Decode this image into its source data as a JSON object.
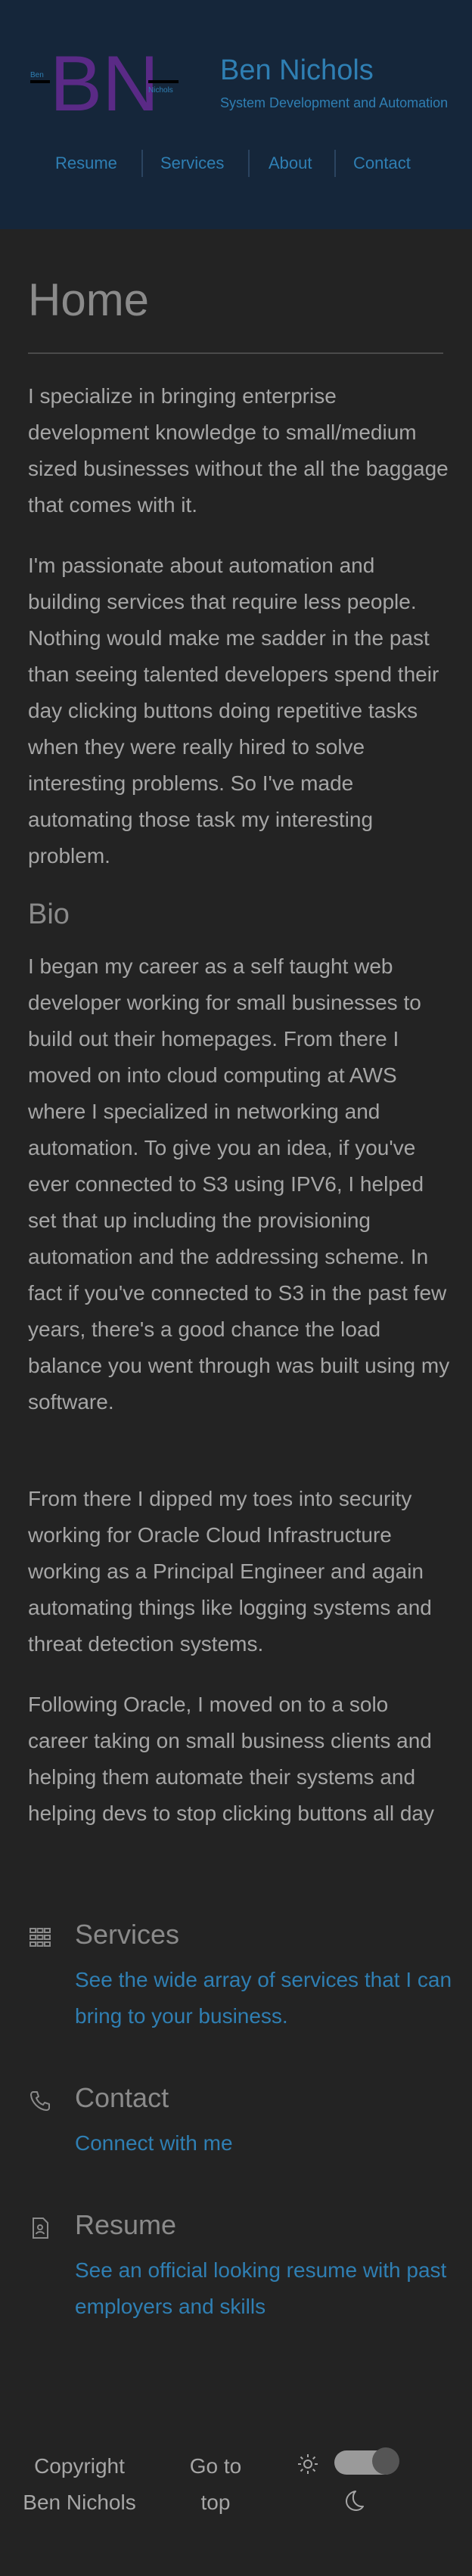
{
  "header": {
    "logo": {
      "letters": "BN",
      "small_left": "Ben",
      "small_right": "Nichols",
      "accent": "#5a2a86"
    },
    "title": "Ben Nichols",
    "subtitle": "System Development and Automation",
    "nav": [
      {
        "label": "Resume"
      },
      {
        "label": "Services"
      },
      {
        "label": "About"
      },
      {
        "label": "Contact"
      }
    ]
  },
  "main": {
    "page_title": "Home",
    "intro": [
      "I specialize in bringing enterprise development knowledge to small/medium sized businesses without the all the baggage that comes with it.",
      "I'm passionate about automation and building services that require less people. Nothing would make me sadder in the past than seeing talented developers spend their day clicking buttons doing repetitive tasks when they were really hired to solve interesting problems. So I've made automating those task my interesting problem."
    ],
    "bio_heading": "Bio",
    "bio": [
      "I began my career as a self taught web developer working for small businesses to build out their homepages. From there I moved on into cloud computing at AWS where I specialized in networking and automation. To give you an idea, if you've ever connected to S3 using IPV6, I helped set that up including the provisioning automation and the addressing scheme. In fact if you've connected to S3 in the past few years, there's a good chance the load balance you went through was built using my software.",
      "From there I dipped my toes into security working for Oracle Cloud Infrastructure working as a Principal Engineer and again automating things like logging systems and threat detection systems.",
      "Following Oracle, I moved on to a solo career taking on small business clients and helping them automate their systems and helping devs to stop clicking buttons all day"
    ],
    "features": [
      {
        "icon": "services-grid-icon",
        "title": "Services",
        "link": "See the wide array of services that I can bring to your business."
      },
      {
        "icon": "phone-icon",
        "title": "Contact",
        "link": "Connect with me"
      },
      {
        "icon": "resume-document-icon",
        "title": "Resume",
        "link": "See an official looking resume with past employers and skills"
      }
    ]
  },
  "footer": {
    "copyright": "Copyright Ben Nichols",
    "go_to_top": "Go to top",
    "theme_toggle": {
      "light_icon": "sun-icon",
      "dark_icon": "moon-icon",
      "state": "dark"
    }
  },
  "colors": {
    "background": "#232323",
    "header_background": "#15263a",
    "link": "#2f7fb3",
    "text": "#a6a6a6",
    "heading": "#8a8a8a"
  }
}
